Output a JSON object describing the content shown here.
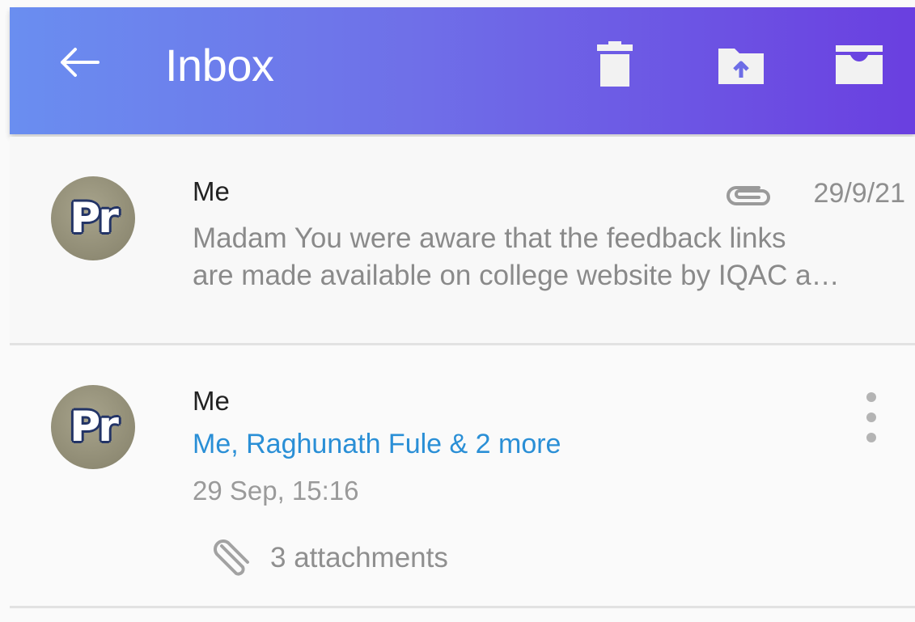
{
  "header": {
    "title": "Inbox",
    "background_colors": [
      "#6a8ef0",
      "#6a3fe0"
    ],
    "icons": [
      "back-arrow-icon",
      "trash-icon",
      "move-to-folder-icon",
      "archive-icon"
    ]
  },
  "messages": [
    {
      "sender": "Me",
      "avatar_text": "Pr",
      "date": "29/9/21",
      "has_attachment_icon": true,
      "preview_line1": "Madam You were aware that the feedback links",
      "preview_line2": "are made available on college website by IQAC a…"
    },
    {
      "sender": "Me",
      "avatar_text": "Pr",
      "recipients": "Me, Raghunath Fule & 2 more",
      "datetime": "29 Sep, 15:16",
      "attachments_label": "3 attachments",
      "recipients_color": "#2a8fd6"
    }
  ]
}
